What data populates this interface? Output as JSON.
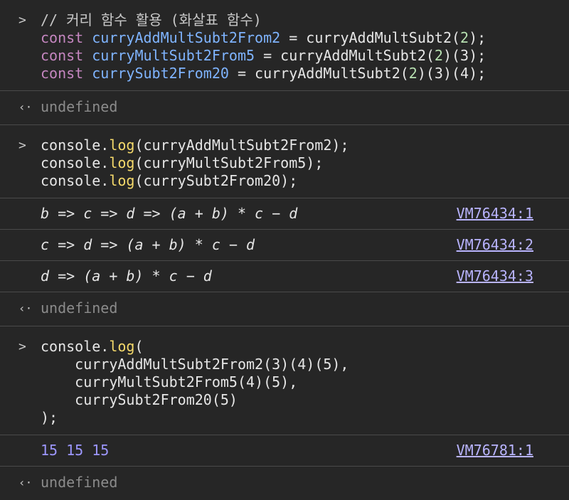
{
  "block1": {
    "prompt": ">",
    "comment": "// 커리 함수 활용 (화살표 함수)",
    "lines": [
      {
        "kw": "const",
        "name": "curryAddMultSubt2From2",
        "eq": " = ",
        "fn": "curryAddMultSubt2",
        "call1": "(",
        "arg1": "2",
        "rest": ");"
      },
      {
        "kw": "const",
        "name": "curryMultSubt2From5",
        "eq": " = ",
        "fn": "curryAddMultSubt2",
        "call1": "(",
        "arg1": "2",
        "rest": ")(3);"
      },
      {
        "kw": "const",
        "name": "currySubt2From20",
        "eq": " = ",
        "fn": "curryAddMultSubt2",
        "call1": "(",
        "arg1": "2",
        "rest": ")(3)(4);"
      }
    ]
  },
  "result1": {
    "prompt": "‹·",
    "text": "undefined"
  },
  "block2": {
    "prompt": ">",
    "lines": [
      {
        "obj": "console.",
        "method": "log",
        "args": "(curryAddMultSubt2From2);"
      },
      {
        "obj": "console.",
        "method": "log",
        "args": "(curryMultSubt2From5);"
      },
      {
        "obj": "console.",
        "method": "log",
        "args": "(currySubt2From20);"
      }
    ]
  },
  "logs1": [
    {
      "text": "b => c => d => (a + b) * c − d",
      "source": "VM76434:1"
    },
    {
      "text": "c => d => (a + b) * c − d",
      "source": "VM76434:2"
    },
    {
      "text": "d => (a + b) * c − d",
      "source": "VM76434:3"
    }
  ],
  "result2": {
    "prompt": "‹·",
    "text": "undefined"
  },
  "block3": {
    "prompt": ">",
    "line1_obj": "console.",
    "line1_method": "log",
    "line1_rest": "(",
    "line2": "    curryAddMultSubt2From2(3)(4)(5),",
    "line3": "    curryMultSubt2From5(4)(5),",
    "line4": "    currySubt2From20(5)",
    "line5": ");"
  },
  "log2": {
    "text": "15 15 15",
    "source": "VM76781:1"
  },
  "result3": {
    "prompt": "‹·",
    "text": "undefined"
  }
}
